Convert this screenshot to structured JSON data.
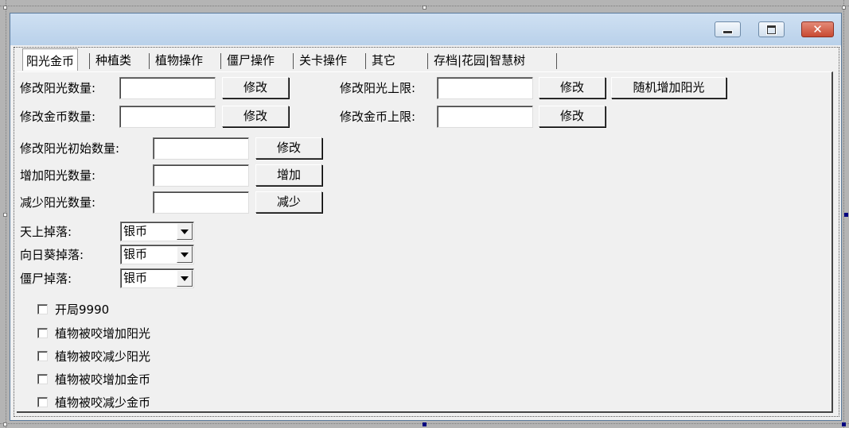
{
  "tabs": [
    {
      "label": "阳光金币",
      "active": true
    },
    {
      "label": "种植类"
    },
    {
      "label": "植物操作"
    },
    {
      "label": "僵尸操作"
    },
    {
      "label": "关卡操作"
    },
    {
      "label": "其它"
    },
    {
      "label": "存档|花园|智慧树"
    }
  ],
  "sun": {
    "modify_sun_label": "修改阳光数量:",
    "modify_sun_value": "",
    "modify_sun_btn": "修改",
    "modify_sun_limit_label": "修改阳光上限:",
    "modify_sun_limit_value": "",
    "modify_sun_limit_btn": "修改",
    "random_add_sun_btn": "随机增加阳光",
    "modify_coin_label": "修改金币数量:",
    "modify_coin_value": "",
    "modify_coin_btn": "修改",
    "modify_coin_limit_label": "修改金币上限:",
    "modify_coin_limit_value": "",
    "modify_coin_limit_btn": "修改",
    "initial_sun_label": "修改阳光初始数量:",
    "initial_sun_value": "",
    "initial_sun_btn": "修改",
    "add_sun_label": "增加阳光数量:",
    "add_sun_value": "",
    "add_sun_btn": "增加",
    "reduce_sun_label": "减少阳光数量:",
    "reduce_sun_value": "",
    "reduce_sun_btn": "减少"
  },
  "drops": [
    {
      "label": "天上掉落:",
      "value": "银币"
    },
    {
      "label": "向日葵掉落:",
      "value": "银币"
    },
    {
      "label": "僵尸掉落:",
      "value": "银币"
    }
  ],
  "checkboxes": [
    {
      "label": "开局9990",
      "checked": false
    },
    {
      "label": "植物被咬增加阳光",
      "checked": false
    },
    {
      "label": "植物被咬减少阳光",
      "checked": false
    },
    {
      "label": "植物被咬增加金币",
      "checked": false
    },
    {
      "label": "植物被咬减少金币",
      "checked": false
    }
  ],
  "colors": {
    "titlebar": "#b9d1ea",
    "close_button": "#c84a32",
    "dialog_bg": "#f0f0f0"
  },
  "icons": {
    "minimize": "minimize-icon",
    "maximize": "maximize-icon",
    "close": "close-icon",
    "dropdown": "chevron-down-icon"
  }
}
